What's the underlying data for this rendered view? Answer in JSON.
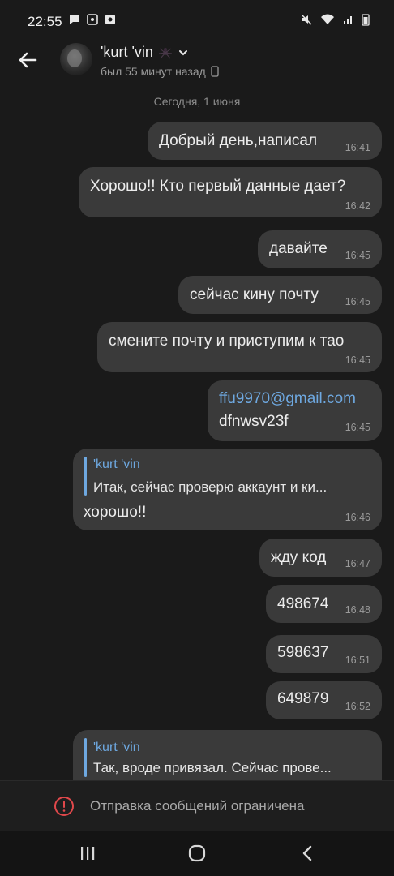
{
  "status_bar": {
    "time": "22:55"
  },
  "header": {
    "name": "'kurt 'vin",
    "last_seen": "был 55 минут назад"
  },
  "date_separator": "Сегодня, 1 июня",
  "messages": [
    {
      "text": "Добрый день,написал",
      "time": "16:41"
    },
    {
      "text": "Хорошо!! Кто первый данные дает?",
      "time": "16:42"
    },
    {
      "text": "давайте",
      "time": "16:45"
    },
    {
      "text": "сейчас кину почту",
      "time": "16:45"
    },
    {
      "text": "смените почту и приступим к тао",
      "time": "16:45"
    },
    {
      "link": "ffu9970@gmail.com",
      "text": "dfnwsv23f",
      "time": "16:45"
    },
    {
      "reply_name": "'kurt 'vin",
      "reply_text": "Итак, сейчас проверю аккаунт и ки...",
      "text": "хорошо!!",
      "time": "16:46"
    },
    {
      "text": "жду код",
      "time": "16:47"
    },
    {
      "text": "498674",
      "time": "16:48"
    },
    {
      "text": "598637",
      "time": "16:51"
    },
    {
      "text": "649879",
      "time": "16:52"
    },
    {
      "reply_name": "'kurt 'vin",
      "reply_text": "Так, вроде привязал. Сейчас прове..."
    }
  ],
  "restriction": {
    "text": "Отправка сообщений ограничена"
  },
  "colors": {
    "background": "#1a1a1a",
    "bubble": "#3a3a3a",
    "accent": "#6ea8e0"
  },
  "icons": [
    "back-arrow-icon",
    "spider-emoji-icon",
    "chevron-down-icon",
    "phone-icon",
    "alert-icon",
    "recents-icon",
    "home-icon",
    "back-nav-icon"
  ]
}
